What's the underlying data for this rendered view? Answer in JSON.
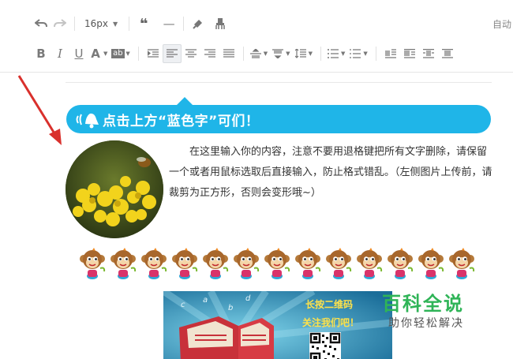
{
  "toolbar": {
    "font_size": "16px",
    "auto_label": "自动",
    "row1": [
      "undo-icon",
      "redo-icon",
      "blockquote-icon",
      "horizontal-rule-icon",
      "format-painter-icon",
      "clear-format-icon"
    ],
    "row2": [
      "bold-icon",
      "italic-icon",
      "underline-icon",
      "font-color-icon",
      "background-color-icon",
      "indent-icon",
      "align-left-icon",
      "align-center-icon",
      "align-right-icon",
      "align-justify-icon",
      "spacing-before-icon",
      "spacing-after-icon",
      "line-height-icon",
      "ordered-list-icon",
      "unordered-list-icon",
      "float-left-icon",
      "float-none-icon",
      "float-center-icon",
      "float-right-icon"
    ],
    "glyphs": {
      "bold": "B",
      "italic": "I",
      "underline": "U",
      "font_color": "A",
      "bg_color": "ab",
      "quote": "❝",
      "hr": "—"
    }
  },
  "content": {
    "banner_text": "点击上方“蓝色字”可们！",
    "banner_color": "#1fb5e8",
    "paragraph": "在这里输入你的内容，注意不要用退格键把所有文字删除，请保留一个或者用鼠标选取后直接输入，防止格式错乱。（左侧图片上传前，请裁剪为正方形，否则会变形哦~）",
    "monkey_count": 13,
    "poster": {
      "line1": "长按二维码",
      "line2": "关注我们吧！"
    },
    "arrow_color": "#d9302c"
  },
  "watermark": {
    "title": "百科全说",
    "subtitle": "助你轻松解决",
    "color": "#2fb457"
  }
}
